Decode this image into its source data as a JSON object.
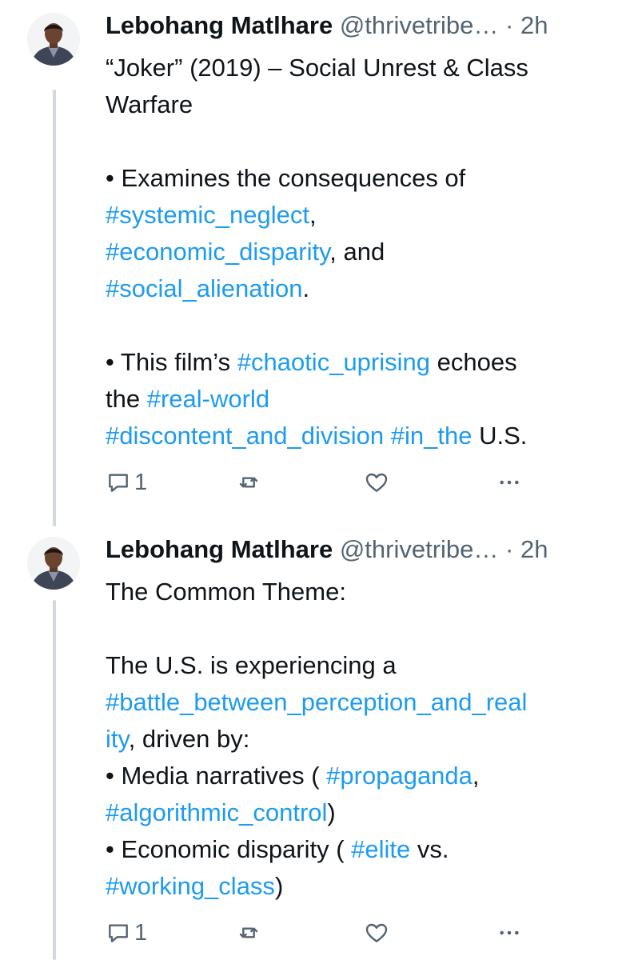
{
  "tweets": [
    {
      "author": "Lebohang Matlhare",
      "handle": "@thrivetribe…",
      "separator": "·",
      "time": "2h",
      "paragraphs": [
        [
          {
            "t": "“Joker” (2019) – Social Unrest & Class"
          }
        ],
        [
          {
            "t": "Warfare"
          }
        ],
        [],
        [
          {
            "t": "• Examines the consequences of"
          }
        ],
        [
          {
            "t": "#systemic_neglect",
            "tag": true
          },
          {
            "t": ","
          }
        ],
        [
          {
            "t": "#economic_disparity",
            "tag": true
          },
          {
            "t": ", and"
          }
        ],
        [
          {
            "t": "#social_alienation",
            "tag": true
          },
          {
            "t": "."
          }
        ],
        [],
        [
          {
            "t": "• This film’s "
          },
          {
            "t": "#chaotic_uprising",
            "tag": true
          },
          {
            "t": " echoes"
          }
        ],
        [
          {
            "t": "the "
          },
          {
            "t": "#real-world",
            "tag": true
          }
        ],
        [
          {
            "t": "#discontent_and_division",
            "tag": true
          },
          {
            "t": " "
          },
          {
            "t": "#in_the",
            "tag": true
          },
          {
            "t": " U.S."
          }
        ]
      ],
      "reply_count": "1",
      "reply_icon": "comment-icon",
      "retweet_icon": "retweet-icon",
      "like_icon": "heart-icon",
      "more_icon": "more-icon"
    },
    {
      "author": "Lebohang Matlhare",
      "handle": "@thrivetribe…",
      "separator": "·",
      "time": "2h",
      "paragraphs": [
        [
          {
            "t": "The Common Theme:"
          }
        ],
        [],
        [
          {
            "t": "The U.S. is experiencing a"
          }
        ],
        [
          {
            "t": "#battle_between_perception_and_real",
            "tag": true
          }
        ],
        [
          {
            "t": "ity",
            "tag": true
          },
          {
            "t": ", driven by:"
          }
        ],
        [
          {
            "t": "• Media narratives ( "
          },
          {
            "t": "#propaganda",
            "tag": true
          },
          {
            "t": ","
          }
        ],
        [
          {
            "t": "#algorithmic_control",
            "tag": true
          },
          {
            "t": ")"
          }
        ],
        [
          {
            "t": "• Economic disparity ( "
          },
          {
            "t": "#elite",
            "tag": true
          },
          {
            "t": " vs."
          }
        ],
        [
          {
            "t": "#working_class",
            "tag": true
          },
          {
            "t": ")"
          }
        ]
      ],
      "reply_count": "1",
      "reply_icon": "comment-icon",
      "retweet_icon": "retweet-icon",
      "like_icon": "heart-icon",
      "more_icon": "more-icon"
    }
  ],
  "colors": {
    "text": "#0f1419",
    "secondary": "#536471",
    "hashtag": "#1d9bf0",
    "thread_line": "#cfd9de"
  }
}
